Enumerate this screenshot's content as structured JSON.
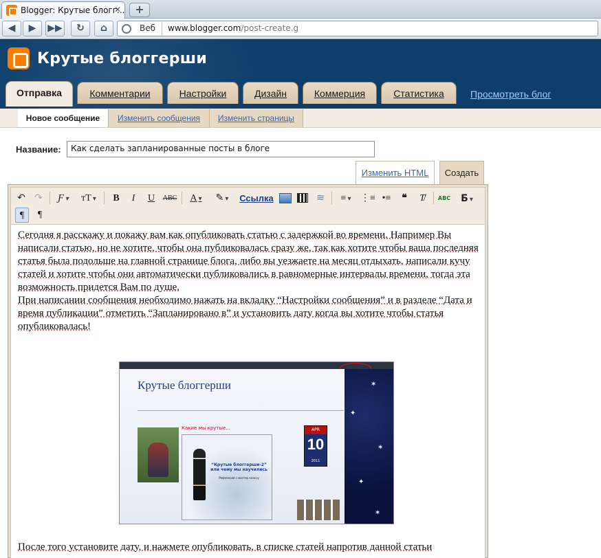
{
  "browser": {
    "tab_title": "Blogger: Крутые блогг...",
    "tab_close": "✕",
    "new_tab": "+",
    "address_label": "Веб",
    "url_host": "www.blogger.com",
    "url_path": "/post-create.g"
  },
  "header": {
    "blog_title": "Крутые блоггерши",
    "tabs": [
      "Отправка",
      "Комментарии",
      "Настройки",
      "Дизайн",
      "Коммерция",
      "Статистика"
    ],
    "view_blog": "Просмотреть блог"
  },
  "subnav": {
    "items": [
      "Новое сообщение",
      "Изменить сообщения",
      "Изменить страницы"
    ]
  },
  "post": {
    "title_label": "Название:",
    "title_value": "Как сделать запланированные посты в блоге",
    "mode_html": "Изменить HTML",
    "mode_compose": "Создать"
  },
  "toolbar": {
    "font": "Ƒ",
    "size": "тТ",
    "bold": "B",
    "italic": "I",
    "underline": "U",
    "strike": "ABC",
    "color": "A",
    "link": "Ссылка",
    "spell": "ABC",
    "lang": "Б",
    "ltr": "¶",
    "rtl": "¶"
  },
  "content": {
    "p1": "Сегодня  я расскажу и покажу вам как  опубликовать статью с задержкой во времени. Например Вы написали статью, но не хотите, чтобы она публиковалась сразу же, так как хотите чтобы ваша последняя статья была подольше на главной странице блога, либо вы уезжаете на месяц отдыхать, написали кучу статей и хотите чтобы они автоматически публиковались в равномерные интервалы времени, тогда эта возможность придется Вам по душе.",
    "p2": "При написании сообщения необходимо нажать на вкладку “Настройки сообщения” и в разделе “Дата и время публикации” отметить “Запланировано в” и установить дату когда вы хотите чтобы статья опубликовалась!",
    "p3": "После того установите дату, и нажмете опубликовать, в списке статей напротив данной статьи"
  },
  "embedded": {
    "title": "Крутые блоггерши",
    "post_title": "Какие мы крутые...",
    "caption": "“Крутые блоггерши-2” или чему мы научились",
    "caption_small": "Рефлексия с мастер классу",
    "cal_month": "APR",
    "cal_day": "10",
    "cal_year": "2011"
  }
}
